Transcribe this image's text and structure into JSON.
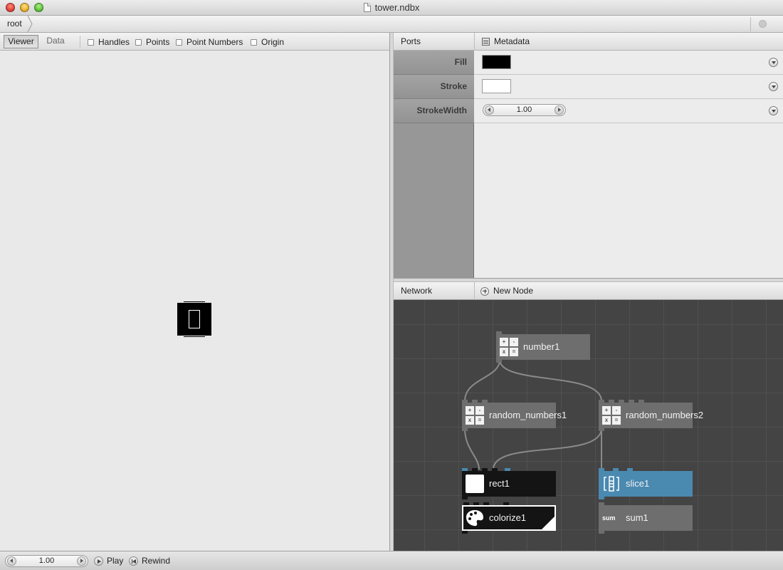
{
  "window": {
    "title": "tower.ndbx"
  },
  "breadcrumb": {
    "items": [
      "root"
    ]
  },
  "viewer": {
    "tabs": {
      "viewer": "Viewer",
      "data": "Data"
    },
    "options": [
      "Handles",
      "Points",
      "Point Numbers",
      "Origin"
    ]
  },
  "ports": {
    "header": {
      "ports_label": "Ports",
      "metadata_label": "Metadata"
    },
    "rows": [
      {
        "label": "Fill",
        "type": "color",
        "color": "#000000"
      },
      {
        "label": "Stroke",
        "type": "color",
        "color": "#ffffff"
      },
      {
        "label": "StrokeWidth",
        "type": "number",
        "value": "1.00"
      }
    ]
  },
  "network": {
    "header": {
      "label": "Network",
      "new_node_label": "New Node"
    },
    "nodes": [
      {
        "name": "number1",
        "icon": "math-icon",
        "style": "gray"
      },
      {
        "name": "random_numbers1",
        "icon": "math-icon",
        "style": "gray"
      },
      {
        "name": "random_numbers2",
        "icon": "math-icon",
        "style": "gray"
      },
      {
        "name": "rect1",
        "icon": "rect-icon",
        "style": "black"
      },
      {
        "name": "slice1",
        "icon": "slice-icon",
        "style": "blue"
      },
      {
        "name": "colorize1",
        "icon": "colorize-icon",
        "style": "black-selected"
      },
      {
        "name": "sum1",
        "icon": "sum-icon",
        "icon_text": "sum",
        "style": "gray"
      }
    ]
  },
  "playback": {
    "frame": "1.00",
    "play_label": "Play",
    "rewind_label": "Rewind"
  },
  "colors": {
    "node_gray": "#6e6e6e",
    "node_blue": "#4a89b0",
    "node_black": "#141414",
    "network_bg": "#444444",
    "wire": "#8a8a8a"
  }
}
